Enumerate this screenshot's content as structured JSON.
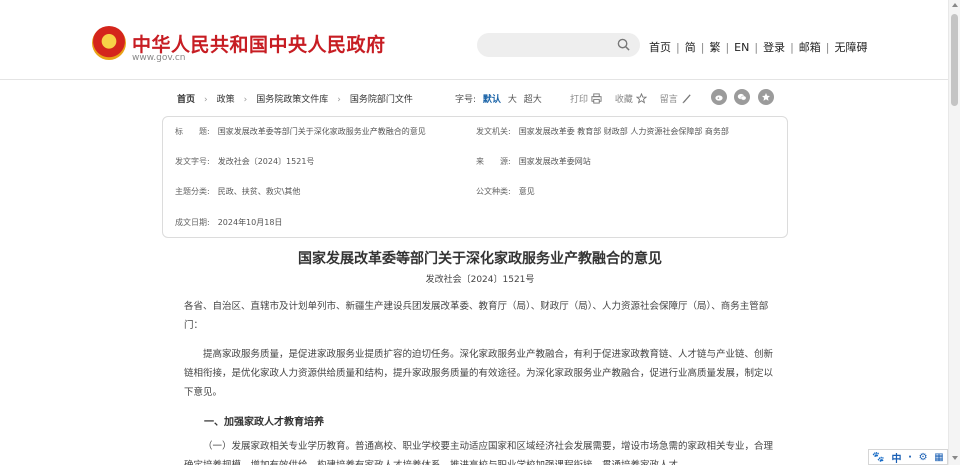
{
  "header": {
    "site_title": "中华人民共和国中央人民政府",
    "site_url": "www.gov.cn",
    "search_placeholder": "",
    "nav": [
      "首页",
      "简",
      "繁",
      "EN",
      "登录",
      "邮箱",
      "无障碍"
    ]
  },
  "breadcrumb": [
    "首页",
    "政策",
    "国务院政策文件库",
    "国务院部门文件"
  ],
  "font_size": {
    "label": "字号:",
    "options": [
      "默认",
      "大",
      "超大"
    ],
    "selected": "默认"
  },
  "tools": {
    "print": "打印",
    "favorite": "收藏",
    "comment": "留言"
  },
  "share_icons": [
    "weibo-icon",
    "wechat-icon",
    "star-icon"
  ],
  "info": {
    "title_label": "标　　题:",
    "title_value": "国家发展改革委等部门关于深化家政服务业产教融合的意见",
    "issuer_label": "发文机关:",
    "issuer_value": "国家发展改革委  教育部  财政部  人力资源社会保障部  商务部",
    "docno_label": "发文字号:",
    "docno_value": "发改社会〔2024〕1521号",
    "source_label": "来　　源:",
    "source_value": "国家发展改革委网站",
    "topic_label": "主题分类:",
    "topic_value": "民政、扶贫、救灾\\其他",
    "type_label": "公文种类:",
    "type_value": "意见",
    "date_label": "成文日期:",
    "date_value": "2024年10月18日"
  },
  "document": {
    "title": "国家发展改革委等部门关于深化家政服务业产教融合的意见",
    "doc_number": "发改社会〔2024〕1521号",
    "salutation": "各省、自治区、直辖市及计划单列市、新疆生产建设兵团发展改革委、教育厅（局）、财政厅（局）、人力资源社会保障厅（局）、商务主管部门：",
    "intro": "提高家政服务质量，是促进家政服务业提质扩容的迫切任务。深化家政服务业产教融合，有利于促进家政教育链、人才链与产业链、创新链相衔接，是优化家政人力资源供给质量和结构，提升家政服务质量的有效途径。为深化家政服务业产教融合，促进行业高质量发展，制定以下意见。",
    "section1_heading": "一、加强家政人才教育培养",
    "section1_p1": "（一）发展家政相关专业学历教育。普通高校、职业学校要主动适应国家和区域经济社会发展需要，增设市场急需的家政相关专业，合理确定培养规模，增加有效供给，构建培养有家政人才培养体系，推进高校与职业学校加强课程衔接，贯通培养家政人才。"
  },
  "ime_toolbar": [
    "paw-icon",
    "中",
    "·",
    "settings-icon",
    "grid-icon"
  ],
  "colors": {
    "brand_red": "#c71d23",
    "accent_blue": "#1b64a8"
  }
}
